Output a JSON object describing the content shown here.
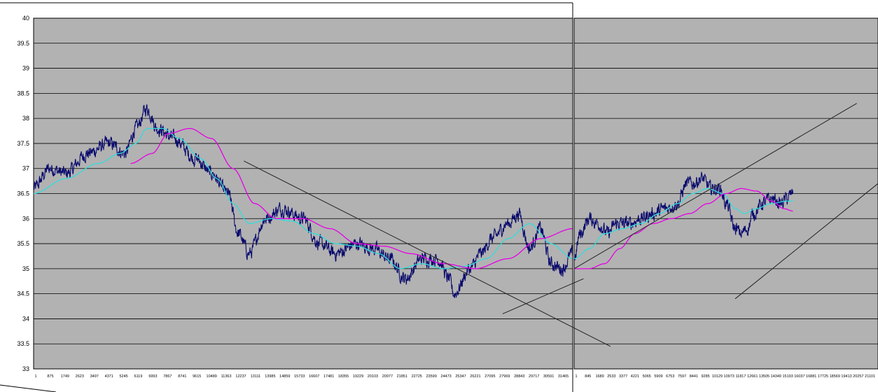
{
  "chart_data": [
    {
      "type": "line",
      "title": "",
      "xlabel": "",
      "ylabel": "",
      "ylim": [
        33,
        40
      ],
      "yticks": [
        "33",
        "33.5",
        "34",
        "34.5",
        "35",
        "35.5",
        "36",
        "36.5",
        "37",
        "37.5",
        "38",
        "38.5",
        "39",
        "39.5",
        "40"
      ],
      "xticks": [
        "1",
        "875",
        "1749",
        "2623",
        "3497",
        "4371",
        "5245",
        "6119",
        "6993",
        "7867",
        "8741",
        "9615",
        "10489",
        "11363",
        "12237",
        "13111",
        "13985",
        "14859",
        "15733",
        "16607",
        "17481",
        "18355",
        "19229",
        "20103",
        "20977",
        "21851",
        "22725",
        "23599",
        "24473",
        "25347",
        "26221",
        "27095",
        "27969",
        "28843",
        "29717",
        "30591",
        "31465"
      ],
      "grid": true,
      "background": "#b2b2b2",
      "series": [
        {
          "color": "#0a0a6e",
          "smooth": "price",
          "x": [
            0,
            0.03,
            0.06,
            0.1,
            0.14,
            0.17,
            0.19,
            0.21,
            0.23,
            0.26,
            0.3,
            0.33,
            0.36,
            0.38,
            0.4,
            0.43,
            0.46,
            0.5,
            0.53,
            0.56,
            0.6,
            0.63,
            0.66,
            0.69,
            0.72,
            0.75,
            0.77,
            0.78,
            0.81,
            0.83,
            0.85,
            0.88,
            0.9,
            0.92,
            0.94,
            0.96,
            0.98,
            1.0
          ],
          "values": [
            36.6,
            37.0,
            36.9,
            37.3,
            37.5,
            37.3,
            37.8,
            38.2,
            37.8,
            37.6,
            37.2,
            36.9,
            36.5,
            35.7,
            35.3,
            36.0,
            36.2,
            36.0,
            35.5,
            35.3,
            35.5,
            35.4,
            35.2,
            34.8,
            35.2,
            35.2,
            34.8,
            34.5,
            35.0,
            35.3,
            35.6,
            35.9,
            36.1,
            35.4,
            35.8,
            35.1,
            35.0,
            35.3
          ]
        },
        {
          "color": "#33dcdc",
          "smooth": "ma-fast",
          "x": [
            0,
            0.06,
            0.12,
            0.16,
            0.19,
            0.21,
            0.24,
            0.27,
            0.31,
            0.34,
            0.37,
            0.4,
            0.44,
            0.48,
            0.52,
            0.56,
            0.6,
            0.64,
            0.68,
            0.72,
            0.76,
            0.8,
            0.84,
            0.88,
            0.92,
            0.96,
            1.0
          ],
          "values": [
            36.5,
            36.8,
            37.1,
            37.3,
            37.5,
            37.8,
            37.8,
            37.6,
            37.2,
            36.8,
            36.3,
            35.9,
            36.0,
            35.95,
            35.7,
            35.5,
            35.45,
            35.3,
            35.0,
            35.1,
            35.0,
            35.05,
            35.2,
            35.6,
            35.9,
            35.5,
            35.2
          ]
        },
        {
          "color": "#e600e6",
          "smooth": "ma-slow",
          "x": [
            0.18,
            0.22,
            0.25,
            0.29,
            0.33,
            0.37,
            0.41,
            0.45,
            0.5,
            0.55,
            0.6,
            0.65,
            0.7,
            0.76,
            0.82,
            0.88,
            0.94,
            1.0
          ],
          "values": [
            37.1,
            37.3,
            37.7,
            37.8,
            37.6,
            37.0,
            36.3,
            36.0,
            36.0,
            35.8,
            35.5,
            35.45,
            35.3,
            35.1,
            35.0,
            35.2,
            35.6,
            35.8
          ]
        }
      ],
      "trendlines": [
        {
          "from": [
            0.39,
            37.15
          ],
          "to": [
            1.07,
            33.45
          ]
        },
        {
          "from": [
            0.87,
            34.1
          ],
          "to": [
            1.02,
            34.8
          ]
        }
      ]
    },
    {
      "type": "line",
      "title": "",
      "xlabel": "",
      "ylabel": "",
      "ylim": [
        33,
        40
      ],
      "xticks": [
        "1",
        "845",
        "1689",
        "2533",
        "3377",
        "4221",
        "5065",
        "5909",
        "6753",
        "7597",
        "8441",
        "9285",
        "10129",
        "10973",
        "11817",
        "12661",
        "13505",
        "14349",
        "15193",
        "16037",
        "16881",
        "17725",
        "18569",
        "19413",
        "20257",
        "21101"
      ],
      "grid": true,
      "background": "#b2b2b2",
      "series": [
        {
          "color": "#0a0a6e",
          "smooth": "price",
          "x": [
            0,
            0.02,
            0.05,
            0.08,
            0.11,
            0.14,
            0.18,
            0.22,
            0.26,
            0.3,
            0.34,
            0.37,
            0.39,
            0.42,
            0.45,
            0.48,
            0.5,
            0.53,
            0.55,
            0.57,
            0.59,
            0.62,
            0.65,
            0.68,
            0.7,
            0.72
          ],
          "values": [
            35.2,
            35.7,
            36.0,
            35.9,
            35.7,
            35.9,
            35.9,
            36.0,
            36.1,
            36.2,
            36.3,
            36.7,
            36.7,
            36.8,
            36.6,
            36.6,
            36.3,
            35.8,
            35.7,
            35.8,
            36.1,
            36.3,
            36.4,
            36.3,
            36.4,
            36.5
          ]
        },
        {
          "color": "#33dcdc",
          "smooth": "ma-fast",
          "x": [
            0,
            0.05,
            0.1,
            0.16,
            0.22,
            0.28,
            0.34,
            0.39,
            0.44,
            0.49,
            0.53,
            0.56,
            0.6,
            0.65,
            0.7,
            0.72
          ],
          "values": [
            35.2,
            35.4,
            35.7,
            35.8,
            35.9,
            36.1,
            36.3,
            36.5,
            36.6,
            36.5,
            36.2,
            36.1,
            36.2,
            36.3,
            36.35,
            36.35
          ]
        },
        {
          "color": "#e600e6",
          "smooth": "ma-slow",
          "x": [
            0,
            0.05,
            0.1,
            0.15,
            0.2,
            0.26,
            0.32,
            0.38,
            0.44,
            0.5,
            0.55,
            0.6,
            0.65,
            0.69,
            0.72
          ],
          "values": [
            35.0,
            35.0,
            35.1,
            35.4,
            35.7,
            35.9,
            36.0,
            36.1,
            36.3,
            36.5,
            36.6,
            36.55,
            36.35,
            36.2,
            36.15
          ]
        }
      ],
      "trendlines": [
        {
          "from": [
            0.0,
            35.0
          ],
          "to": [
            0.93,
            38.3
          ]
        },
        {
          "from": [
            0.53,
            34.4
          ],
          "to": [
            1.0,
            36.7
          ]
        }
      ]
    }
  ]
}
